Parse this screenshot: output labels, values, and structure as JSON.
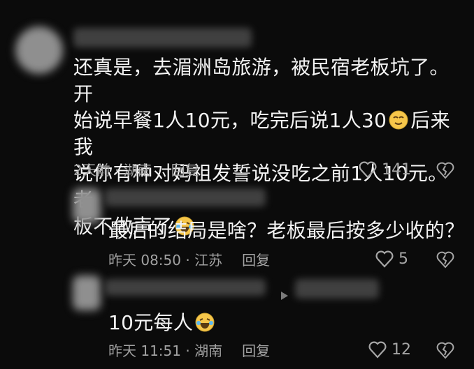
{
  "comments": [
    {
      "text_lines": [
        "还真是，去湄洲岛旅游，被民宿老板坑了。开",
        "始说早餐1人10元，吃完后说1人30",
        "后来我",
        "说你有种对妈祖发誓说没吃之前1人10元。老",
        "板不做声了"
      ],
      "meta": "2天前 · 湖南",
      "reply_label": "回复",
      "likes": "141"
    },
    {
      "text": "最后的结局是啥？老板最后按多少收的？",
      "meta": "昨天 08:50 · 江苏",
      "reply_label": "回复",
      "likes": "5"
    },
    {
      "text": "10元每人",
      "meta": "昨天 11:51 · 湖南",
      "reply_label": "回复",
      "likes": "12"
    }
  ],
  "icons": {
    "like": "heart-outline-icon",
    "dislike": "broken-heart-icon",
    "emoji1": "smirk-emoji-icon",
    "emoji2": "laugh-cry-emoji-icon",
    "play": "play-arrow-icon"
  }
}
